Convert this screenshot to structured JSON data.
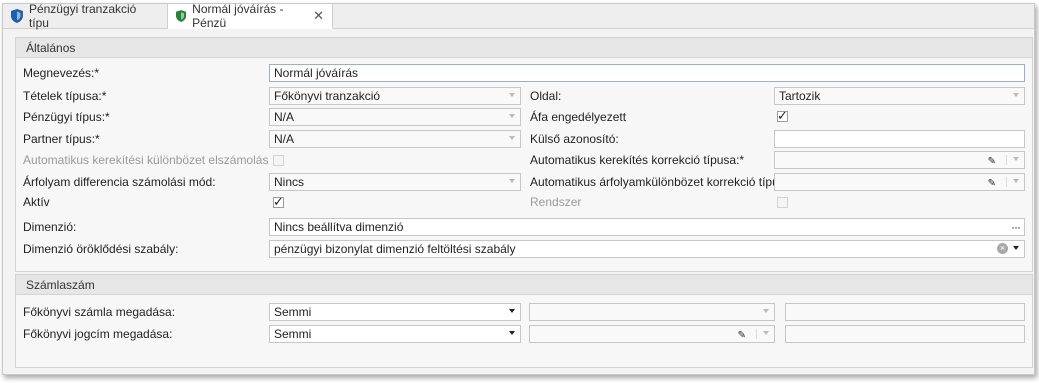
{
  "tabs": [
    {
      "label": "Pénzügyi tranzakció típu",
      "icon": "shield-icon"
    },
    {
      "label": "Normál jóváírás - Pénzü",
      "icon": "shield-icon",
      "close": "✕"
    }
  ],
  "general": {
    "title": "Általános",
    "megnevezes": {
      "label": "Megnevezés:*",
      "value": "Normál jóváírás"
    },
    "tetelek_tipusa": {
      "label": "Tételek típusa:*",
      "value": "Főkönyvi tranzakció"
    },
    "oldal": {
      "label": "Oldal:",
      "value": "Tartozik"
    },
    "penzugyi_tipus": {
      "label": "Pénzügyi típus:*",
      "value": "N/A"
    },
    "afa": {
      "label": "Áfa engedélyezett",
      "checked": true
    },
    "partner_tipus": {
      "label": "Partner típus:*",
      "value": "N/A"
    },
    "kulso_azonosito": {
      "label": "Külső azonosító:",
      "value": ""
    },
    "auto_kerekitesi": {
      "label": "Automatikus kerekítési különbözet elszámolás",
      "checked": false
    },
    "auto_kerekites_korrekcio": {
      "label": "Automatikus kerekítés korrekció típusa:*",
      "value": ""
    },
    "arfolyam_mod": {
      "label": "Árfolyam differencia számolási mód:",
      "value": "Nincs"
    },
    "auto_arfolyam_korrekcio": {
      "label": "Automatikus árfolyamkülönbözet korrekció típus:*",
      "value": ""
    },
    "aktiv": {
      "label": "Aktív",
      "checked": true
    },
    "rendszer": {
      "label": "Rendszer",
      "checked": false
    },
    "dimenzio": {
      "label": "Dimenzió:",
      "value": "Nincs beállítva dimenzió",
      "dots": "···"
    },
    "dim_orokl": {
      "label": "Dimenzió öröklődési szabály:",
      "value": "pénzügyi bizonylat dimenzió feltöltési szabály",
      "clear": "×"
    }
  },
  "szamlaszam": {
    "title": "Számlaszám",
    "fokonyvi_szamla": {
      "label": "Főkönyvi számla megadása:",
      "value": "Semmi"
    },
    "fokonyvi_jogcim": {
      "label": "Főkönyvi jogcím megadása:",
      "value": "Semmi"
    }
  },
  "icons": {
    "pencil": "✎",
    "check": "✓"
  },
  "colors": {
    "shield_blue": "#1f5fa8",
    "shield_green": "#3aa05a",
    "accent_border": "#9ab0c9"
  }
}
